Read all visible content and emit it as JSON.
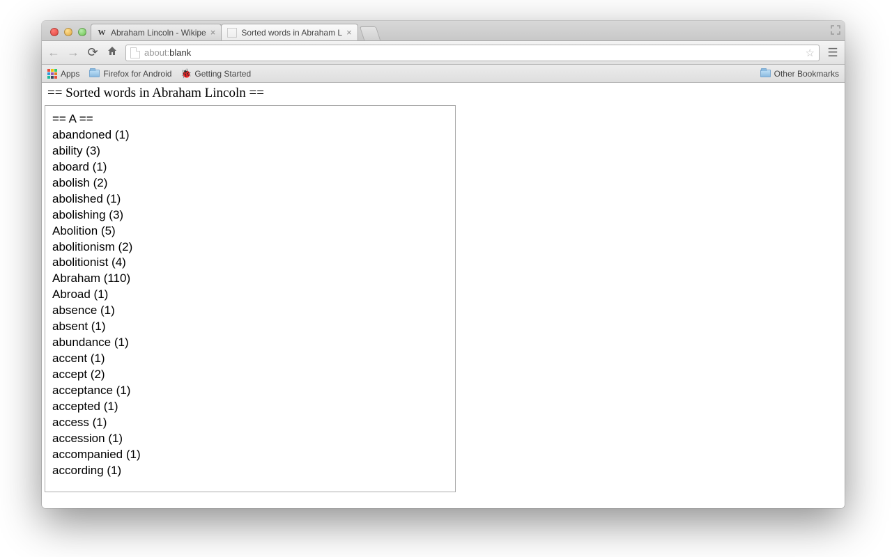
{
  "tabs": [
    {
      "title": "Abraham Lincoln - Wikipe",
      "favicon": "W",
      "active": false
    },
    {
      "title": "Sorted words in Abraham L",
      "favicon": "page",
      "active": true
    }
  ],
  "url": {
    "scheme": "about:",
    "rest": "blank"
  },
  "bookmarks_bar": {
    "apps": "Apps",
    "items": [
      {
        "icon": "folder",
        "label": "Firefox for Android"
      },
      {
        "icon": "bug",
        "label": "Getting Started"
      }
    ],
    "other": "Other Bookmarks"
  },
  "page": {
    "heading": "== Sorted words in Abraham Lincoln ==",
    "section": "== A ==",
    "words": [
      {
        "w": "abandoned",
        "n": 1
      },
      {
        "w": "ability",
        "n": 3
      },
      {
        "w": "aboard",
        "n": 1
      },
      {
        "w": "abolish",
        "n": 2
      },
      {
        "w": "abolished",
        "n": 1
      },
      {
        "w": "abolishing",
        "n": 3
      },
      {
        "w": "Abolition",
        "n": 5
      },
      {
        "w": "abolitionism",
        "n": 2
      },
      {
        "w": "abolitionist",
        "n": 4
      },
      {
        "w": "Abraham",
        "n": 110
      },
      {
        "w": "Abroad",
        "n": 1
      },
      {
        "w": "absence",
        "n": 1
      },
      {
        "w": "absent",
        "n": 1
      },
      {
        "w": "abundance",
        "n": 1
      },
      {
        "w": "accent",
        "n": 1
      },
      {
        "w": "accept",
        "n": 2
      },
      {
        "w": "acceptance",
        "n": 1
      },
      {
        "w": "accepted",
        "n": 1
      },
      {
        "w": "access",
        "n": 1
      },
      {
        "w": "accession",
        "n": 1
      },
      {
        "w": "accompanied",
        "n": 1
      },
      {
        "w": "according",
        "n": 1
      }
    ]
  }
}
